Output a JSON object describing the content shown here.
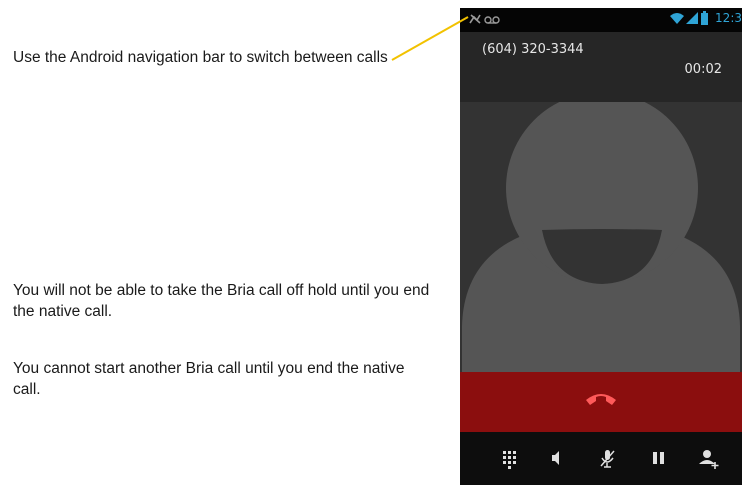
{
  "annotations": {
    "navigation_note": "Use the Android navigation bar to switch between calls",
    "hold_note": "You will not be able to take the Bria call off hold until you end the native call.",
    "start_note": "You cannot start another Bria call until you end the native call."
  },
  "statusbar": {
    "time": "12:3",
    "icons": [
      "missed-call-icon",
      "voicemail-icon",
      "wifi-icon",
      "signal-icon",
      "battery-icon"
    ]
  },
  "call": {
    "number": "(604) 320-3344",
    "duration": "00:02"
  },
  "controls": {
    "buttons": [
      "dialpad-icon",
      "speaker-icon",
      "mute-icon",
      "hold-icon",
      "add-call-icon"
    ]
  },
  "colors": {
    "endcall_red": "#8b0e0e",
    "callout_yellow": "#f2c200",
    "accent_blue": "#2fa4d6"
  }
}
